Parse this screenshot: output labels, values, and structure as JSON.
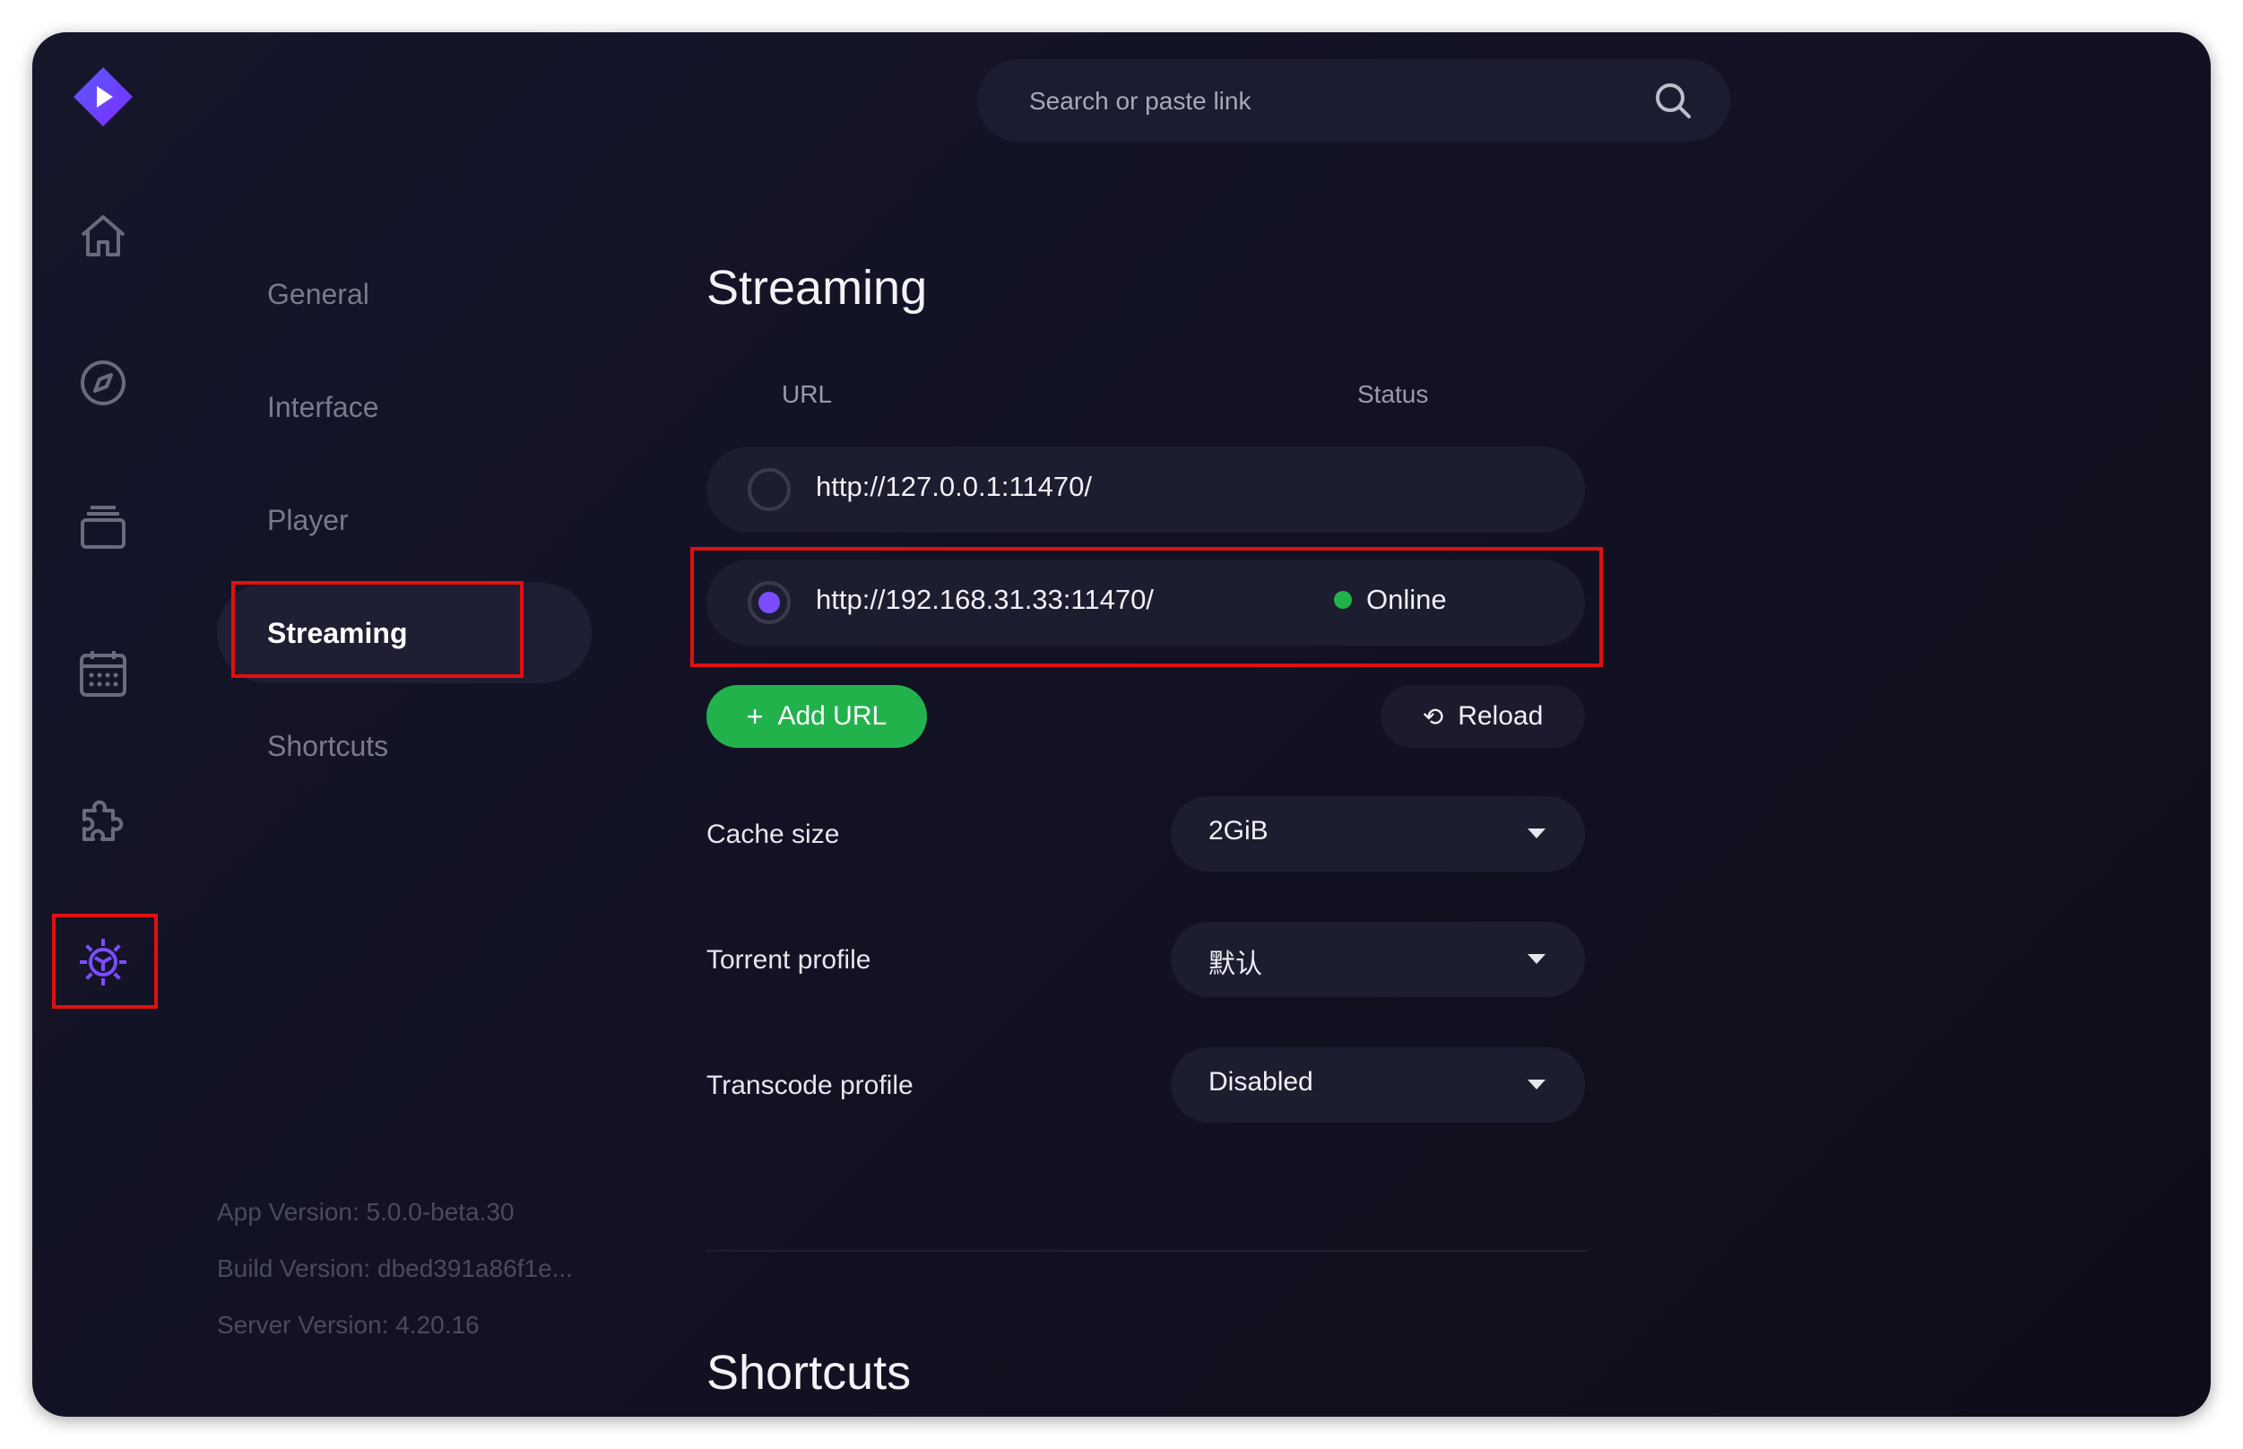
{
  "search": {
    "placeholder": "Search or paste link"
  },
  "rail": {
    "icons": [
      "home-icon",
      "compass-icon",
      "library-icon",
      "calendar-icon",
      "addons-icon",
      "settings-icon"
    ]
  },
  "nav": {
    "items": [
      {
        "label": "General"
      },
      {
        "label": "Interface"
      },
      {
        "label": "Player"
      },
      {
        "label": "Streaming"
      },
      {
        "label": "Shortcuts"
      }
    ],
    "active": "Streaming"
  },
  "versions": {
    "app": "App Version: 5.0.0-beta.30",
    "build": "Build Version: dbed391a86f1e...",
    "server": "Server Version: 4.20.16"
  },
  "streaming": {
    "title": "Streaming",
    "col_url": "URL",
    "col_status": "Status",
    "urls": [
      {
        "url": "http://127.0.0.1:11470/",
        "status": "",
        "selected": false
      },
      {
        "url": "http://192.168.31.33:11470/",
        "status": "Online",
        "selected": true
      }
    ],
    "add_label": "Add URL",
    "reload_label": "Reload",
    "cache_label": "Cache size",
    "cache_value": "2GiB",
    "torrent_label": "Torrent profile",
    "torrent_value": "默认",
    "transcode_label": "Transcode profile",
    "transcode_value": "Disabled"
  },
  "shortcuts": {
    "title": "Shortcuts"
  },
  "colors": {
    "accent": "#7b4dff",
    "online": "#22b24c",
    "add_button": "#22b24c",
    "highlight": "#e01010"
  }
}
